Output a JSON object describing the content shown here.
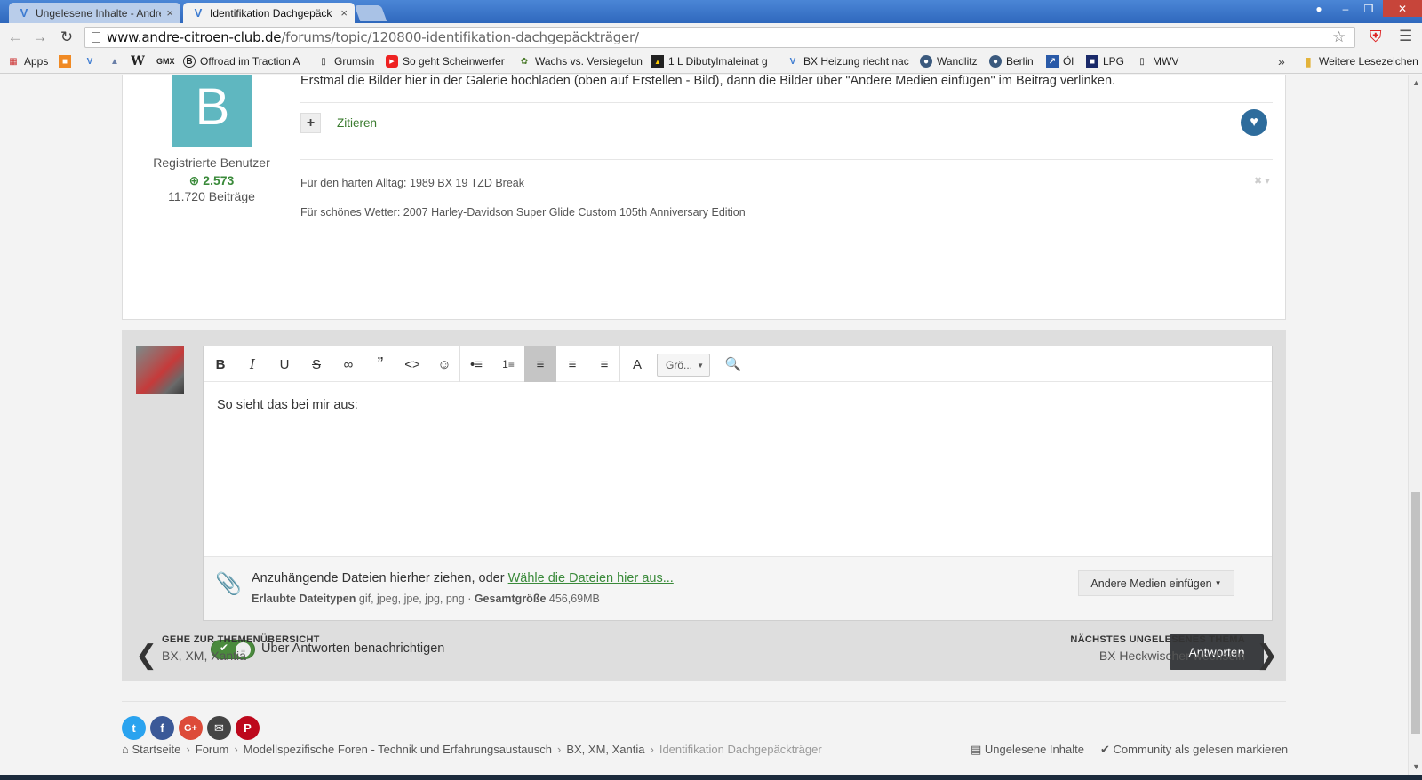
{
  "browser": {
    "tabs": [
      {
        "title": "Ungelesene Inhalte - Andre",
        "active": false
      },
      {
        "title": "Identifikation Dachgepäck",
        "active": true
      }
    ],
    "tab_close": "×",
    "url_domain": "www.andre-citroen-club.de",
    "url_path": "/forums/topic/120800-identifikation-dachgepäckträger/"
  },
  "bookmarks": {
    "items": [
      {
        "label": "Apps",
        "icon": "apps-grid-icon"
      },
      {
        "label": "",
        "icon": "bookmark-orange-icon"
      },
      {
        "label": "",
        "icon": "bookmark-v-icon"
      },
      {
        "label": "",
        "icon": "bookmark-page-icon"
      },
      {
        "label": "",
        "icon": "wikipedia-icon"
      },
      {
        "label": "GMX",
        "icon": "gmx-icon"
      },
      {
        "label": "Offroad im Traction A",
        "icon": "b-circle-icon"
      },
      {
        "label": "Grumsin",
        "icon": "page-icon"
      },
      {
        "label": "So geht Scheinwerfer",
        "icon": "youtube-icon"
      },
      {
        "label": "Wachs vs. Versiegelun",
        "icon": "leaf-icon"
      },
      {
        "label": "1 L Dibutylmaleinat g",
        "icon": "shop-icon"
      },
      {
        "label": "BX Heizung riecht nac",
        "icon": "bookmark-v-icon"
      },
      {
        "label": "Wandlitz",
        "icon": "globe-icon"
      },
      {
        "label": "Berlin",
        "icon": "globe-icon"
      },
      {
        "label": "Öl",
        "icon": "chart-icon"
      },
      {
        "label": "LPG",
        "icon": "box-icon"
      },
      {
        "label": "MWV",
        "icon": "page-icon"
      }
    ],
    "more": "»",
    "other_folder": "Weitere Lesezeichen"
  },
  "post": {
    "avatar_letter": "B",
    "author_group": "Registrierte Benutzer",
    "reputation": "2.573",
    "post_count": "11.720 Beiträge",
    "text": "Erstmal die Bilder hier in der Galerie hochladen (oben auf Erstellen - Bild), dann die Bilder über \"Andere Medien einfügen\" im Beitrag verlinken.",
    "quote_label": "Zitieren",
    "signature": [
      "Für den harten Alltag: 1989 BX 19 TZD Break",
      "Für schönes Wetter: 2007 Harley-Davidson Super Glide Custom 105th Anniversary Edition"
    ]
  },
  "editor": {
    "font_size_label": "Grö...",
    "content": "So sieht das bei mir aus:",
    "attach_text": "Anzuhängende Dateien hierher ziehen, oder ",
    "attach_link": "Wähle die Dateien hier aus...",
    "allowed_types_label": "Erlaubte Dateitypen",
    "allowed_types": "gif, jpeg, jpe, jpg, png",
    "total_size_label": "Gesamtgröße",
    "total_size": "456,69MB",
    "other_media": "Andere Medien einfügen",
    "notify_label": "Über Antworten benachrichtigen",
    "submit": "Antworten"
  },
  "pager": {
    "prev_label": "GEHE ZUR THEMENÜBERSICHT",
    "prev_title": "BX, XM, Xantia",
    "next_label": "NÄCHSTES UNGELESENES THEMA",
    "next_title": "BX Heckwischer wechseln"
  },
  "breadcrumb": [
    "Startseite",
    "Forum",
    "Modellspezifische Foren - Technik und Erfahrungsaustausch",
    "BX, XM, Xantia",
    "Identifikation Dachgepäckträger"
  ],
  "footer": {
    "unread": "Ungelesene Inhalte",
    "mark_read": "Community als gelesen markieren"
  },
  "colors": {
    "accent_green": "#3a8a3a",
    "avatar_teal": "#5fb7c0",
    "heart_blue": "#2e6c9c",
    "submit_dark": "#3b3d40",
    "tab_bar_blue": "#3a74c8"
  }
}
